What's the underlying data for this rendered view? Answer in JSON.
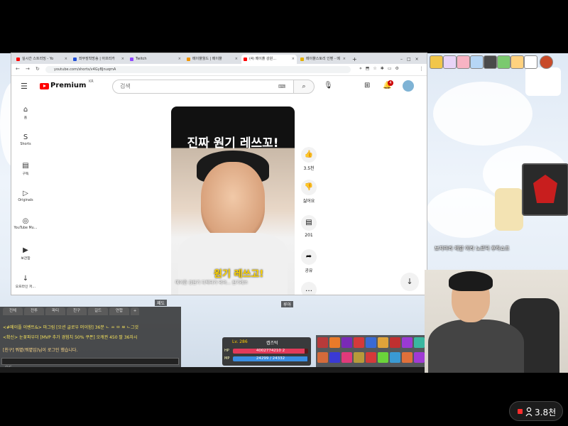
{
  "browser": {
    "tabs": [
      {
        "label": "실시간 스트리밍 - Yo",
        "color": "#ff0000"
      },
      {
        "label": "좌부장착방송 | 아프리카",
        "color": "#1f4fd8"
      },
      {
        "label": "Twitch",
        "color": "#9146ff"
      },
      {
        "label": "메이플월드 | 메이플",
        "color": "#f29500"
      },
      {
        "label": "(4) 메이플 강원…",
        "color": "#ff0000"
      },
      {
        "label": "메이플스토리 인벤 - 메",
        "color": "#e3b000"
      }
    ],
    "new_tab": "+",
    "url": "youtube.com/shorts/v4GyBJnuqmA",
    "nav": {
      "back": "←",
      "forward": "→",
      "reload": "↻"
    }
  },
  "youtube": {
    "logo_text": "Premium",
    "logo_region": "KR",
    "search_placeholder": "검색",
    "notification_count": "4",
    "sidebar": [
      {
        "label": "홈",
        "icon": "⌂"
      },
      {
        "label": "Shorts",
        "icon": "S"
      },
      {
        "label": "구독",
        "icon": "▤"
      },
      {
        "label": "Originals",
        "icon": "▷"
      },
      {
        "label": "YouTube Mu…",
        "icon": "◎"
      },
      {
        "label": "보관함",
        "icon": "▶"
      },
      {
        "label": "오프라인 저…",
        "icon": "↓"
      }
    ],
    "video": {
      "title_overlay": "진짜 원기 레쓰꼬!",
      "sticker": "원기 레쓰고!",
      "caption": "메이플 강원기 디렉터가 외쳐… 원기레쓰"
    },
    "actions": {
      "like_count": "3.5천",
      "dislike_label": "싫어요",
      "comment_count": "201",
      "share_label": "공유",
      "more_label": "…"
    }
  },
  "game": {
    "chat_tabs": [
      "전체",
      "전투",
      "파티",
      "친구",
      "길드",
      "연합",
      "+"
    ],
    "chat_lines": [
      {
        "text": "<#메이플 이벤트&> 마그림 [오션 글로우 머이함] 36분 ㄴ ㅆ ㅁ ㅉ ㄴ그것",
        "color": "#f5e25c"
      },
      {
        "text": "<확신> 눈꽃파우더 [MVP 추가 경험치 50% 쿠폰] 오캐권 450 팔 36자시",
        "color": "#f5e25c"
      },
      {
        "text": "[친구] 뭐볕(뭐볕임)님이 로그인 했습니다.",
        "color": "#ffd98a"
      }
    ],
    "chat_input_label": "모두",
    "status": {
      "level": "Lv. 286",
      "name": "캡즈턱",
      "hp_label": "HP",
      "mp_label": "MP",
      "hp": "4002774210 2",
      "mp": "24299 / 24332",
      "hp_fraction": 0.95,
      "mp_fraction": 0.99
    },
    "watch_notice": "보지마라 제발 이라 노르딕 후하쇼프",
    "nameplates": [
      "루아",
      "제도"
    ]
  },
  "stream": {
    "viewer_count": "3.8천",
    "live_color": "#ff2d2d"
  }
}
